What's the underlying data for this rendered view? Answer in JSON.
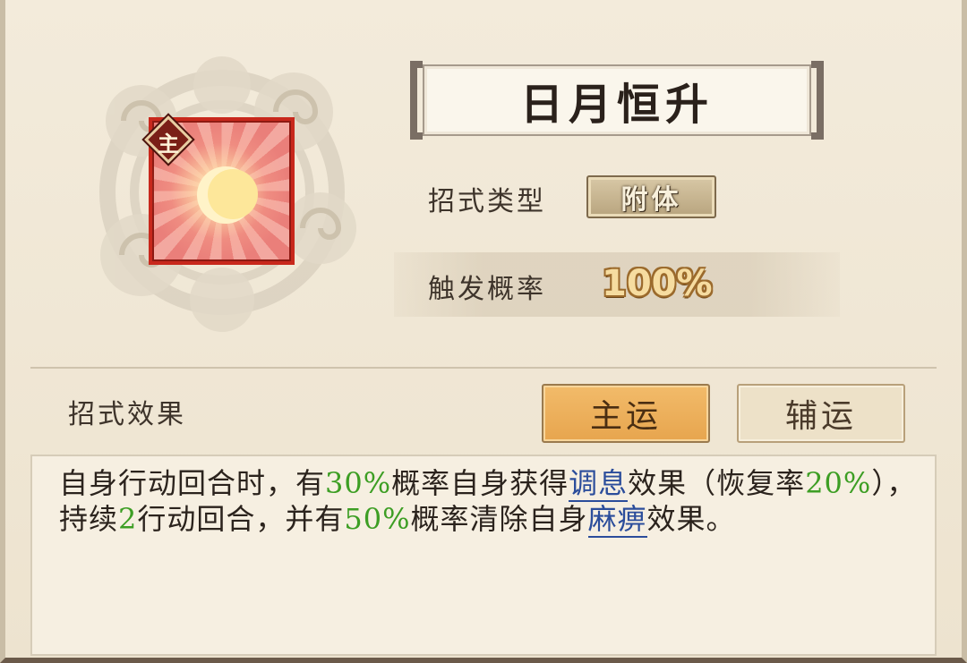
{
  "skill": {
    "badge": "主",
    "title": "日月恒升"
  },
  "type_row": {
    "label": "招式类型",
    "value": "附体"
  },
  "rate_row": {
    "label": "触发概率",
    "value": "100%"
  },
  "effect": {
    "label": "招式效果",
    "tabs": [
      {
        "label": "主运",
        "active": true
      },
      {
        "label": "辅运",
        "active": false
      }
    ],
    "text": {
      "p1": "自身行动回合时，有",
      "v1": "30%",
      "p2": "概率自身获得",
      "k1": "调息",
      "p3": "效果（恢复率",
      "v2": "20%",
      "p4": "），持续",
      "v3": "2",
      "p5": "行动回合，并有",
      "v4": "50%",
      "p6": "概率清除自身",
      "k2": "麻痹",
      "p7": "效果。"
    }
  },
  "colors": {
    "highlight_value": "#3d9e24",
    "keyword": "#2b4d9b",
    "active_tab": "#eeb15c",
    "icon_border": "#c8281c"
  },
  "icons": [
    "cloud-emblem",
    "moon-sun-icon"
  ]
}
